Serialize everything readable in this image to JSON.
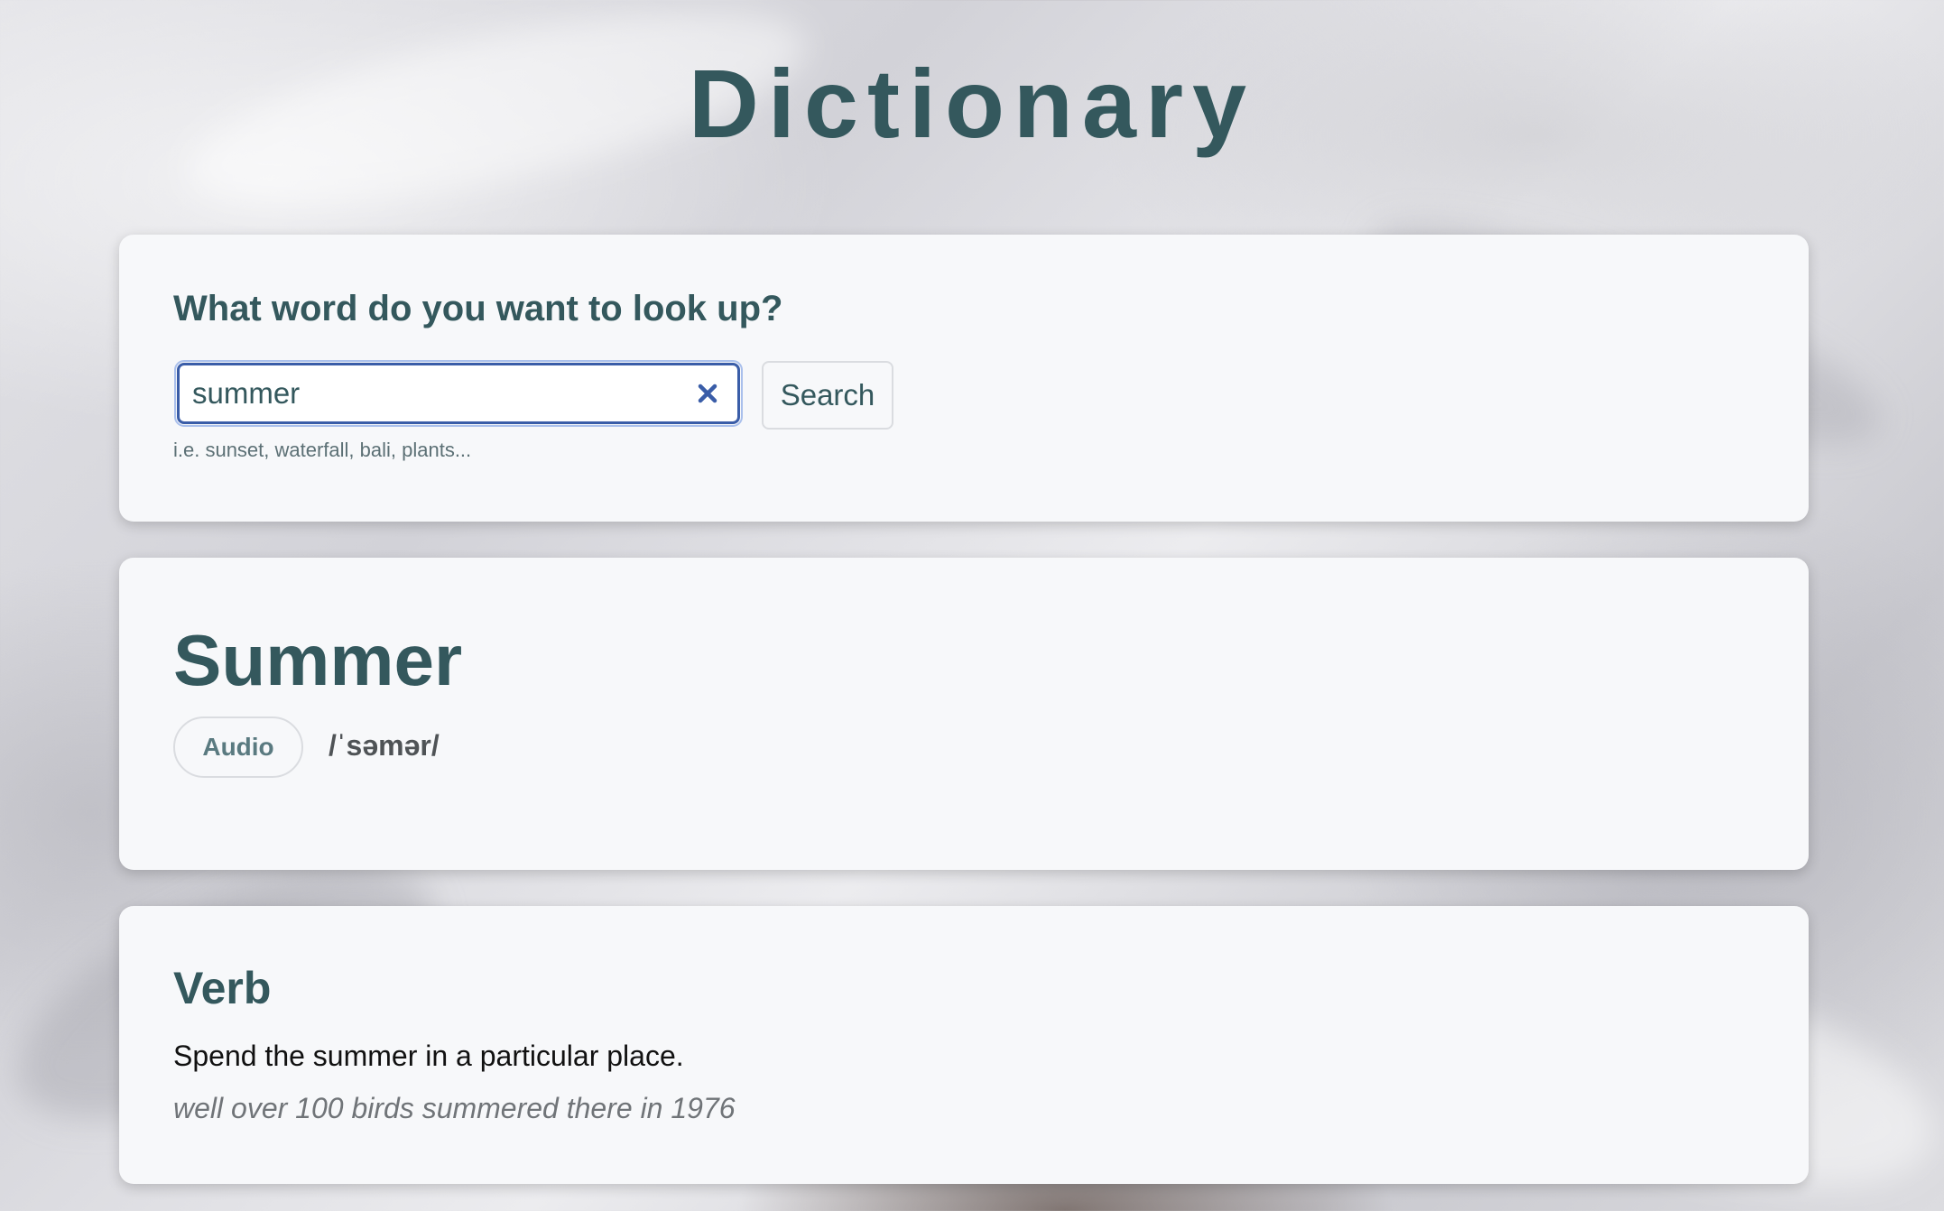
{
  "app": {
    "title": "Dictionary"
  },
  "search": {
    "heading": "What word do you want to look up?",
    "value": "summer",
    "hint": "i.e. sunset, waterfall, bali, plants...",
    "button_label": "Search",
    "clear_icon": "close-icon"
  },
  "word": {
    "title": "Summer",
    "audio_label": "Audio",
    "phonetic": "/ˈsəmər/"
  },
  "meaning": {
    "part_of_speech": "Verb",
    "definition": "Spend the summer in a particular place.",
    "example": "well over 100 birds summered there in 1976"
  },
  "colors": {
    "accent": "#34585d",
    "card_background": "#f7f8fa",
    "input_focus_border": "#3a5da8",
    "example_text": "#707478"
  }
}
